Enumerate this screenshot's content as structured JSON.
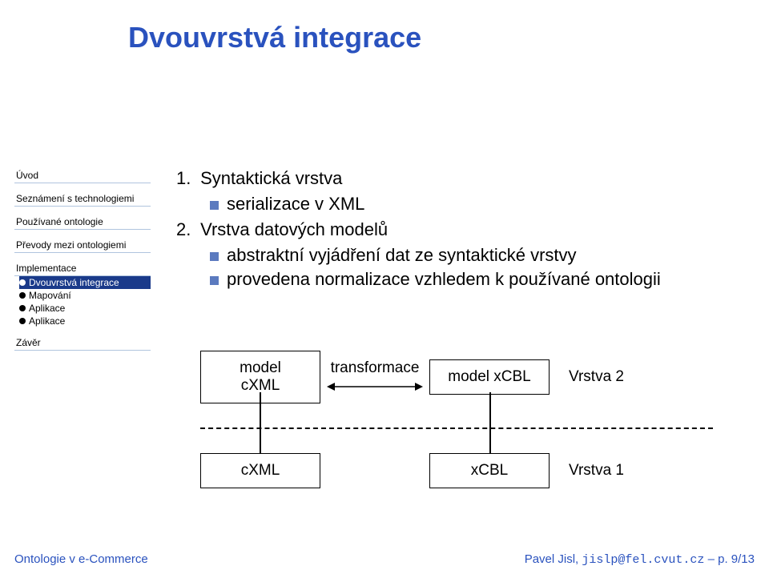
{
  "title": "Dvouvrstvá integrace",
  "sidebar": {
    "items": [
      "Úvod",
      "Seznámení s technologiemi",
      "Používané ontologie",
      "Převody mezi ontologiemi",
      "Implementace",
      "Závěr"
    ],
    "sub": [
      {
        "label": "Dvouvrstvá integrace",
        "active": true
      },
      {
        "label": "Mapování",
        "active": false
      },
      {
        "label": "Aplikace",
        "active": false
      },
      {
        "label": "Aplikace",
        "active": false
      }
    ]
  },
  "content": {
    "item1_num": "1.",
    "item1_text": "Syntaktická vrstva",
    "item1_sub1": "serializace v XML",
    "item2_num": "2.",
    "item2_text": "Vrstva datových modelů",
    "item2_sub1": "abstraktní vyjádření dat ze syntaktické vrstvy",
    "item2_sub2": "provedena normalizace vzhledem k používané ontologii"
  },
  "diagram": {
    "box_model_cxml": "model cXML",
    "box_model_xcbl": "model xCBL",
    "arrow_label": "transformace",
    "layer2": "Vrstva 2",
    "box_cxml": "cXML",
    "box_xcbl": "xCBL",
    "layer1": "Vrstva 1"
  },
  "footer": {
    "left": "Ontologie v e-Commerce",
    "right_name": "Pavel Jisl, ",
    "right_email": "jislp@fel.cvut.cz",
    "right_page": " – p. 9/13"
  }
}
